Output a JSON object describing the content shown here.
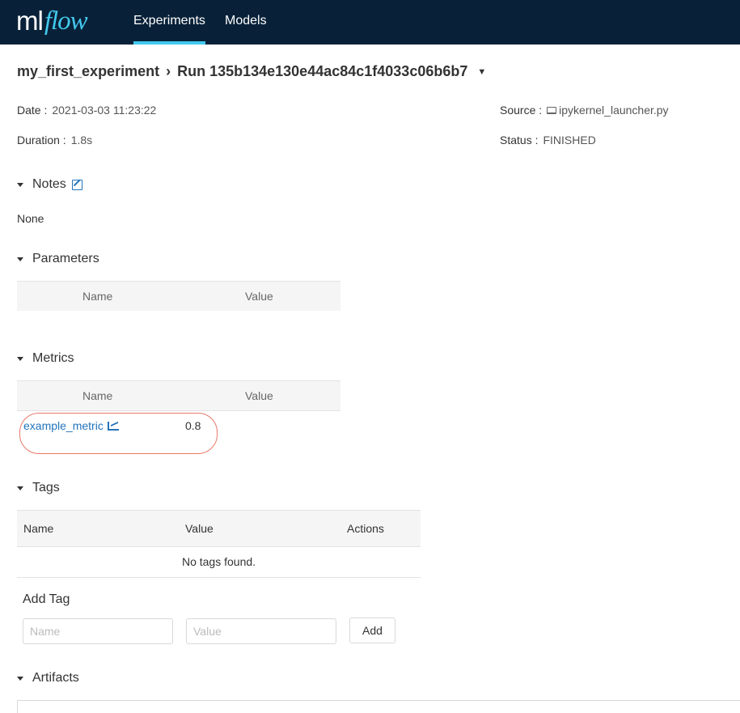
{
  "header": {
    "logo_ml": "ml",
    "logo_flow": "flow",
    "nav": [
      {
        "label": "Experiments"
      },
      {
        "label": "Models"
      }
    ]
  },
  "breadcrumb": {
    "experiment": "my_first_experiment",
    "run": "Run 135b134e130e44ac84c1f4033c06b6b7"
  },
  "meta": {
    "date_label": "Date :",
    "date_value": "2021-03-03 11:23:22",
    "duration_label": "Duration :",
    "duration_value": "1.8s",
    "source_label": "Source :",
    "source_value": "ipykernel_launcher.py",
    "status_label": "Status :",
    "status_value": "FINISHED"
  },
  "notes": {
    "title": "Notes",
    "value": "None"
  },
  "parameters": {
    "title": "Parameters",
    "columns": [
      "Name",
      "Value"
    ]
  },
  "metrics": {
    "title": "Metrics",
    "columns": [
      "Name",
      "Value"
    ],
    "rows": [
      {
        "name": "example_metric",
        "value": "0.8"
      }
    ]
  },
  "tags": {
    "title": "Tags",
    "columns": [
      "Name",
      "Value",
      "Actions"
    ],
    "empty_text": "No tags found.",
    "add_title": "Add Tag",
    "name_placeholder": "Name",
    "value_placeholder": "Value",
    "add_label": "Add"
  },
  "artifacts": {
    "title": "Artifacts"
  },
  "colors": {
    "header_bg": "#082138",
    "accent": "#43c9ed",
    "link": "#2374bb",
    "highlight": "#e8786c"
  }
}
